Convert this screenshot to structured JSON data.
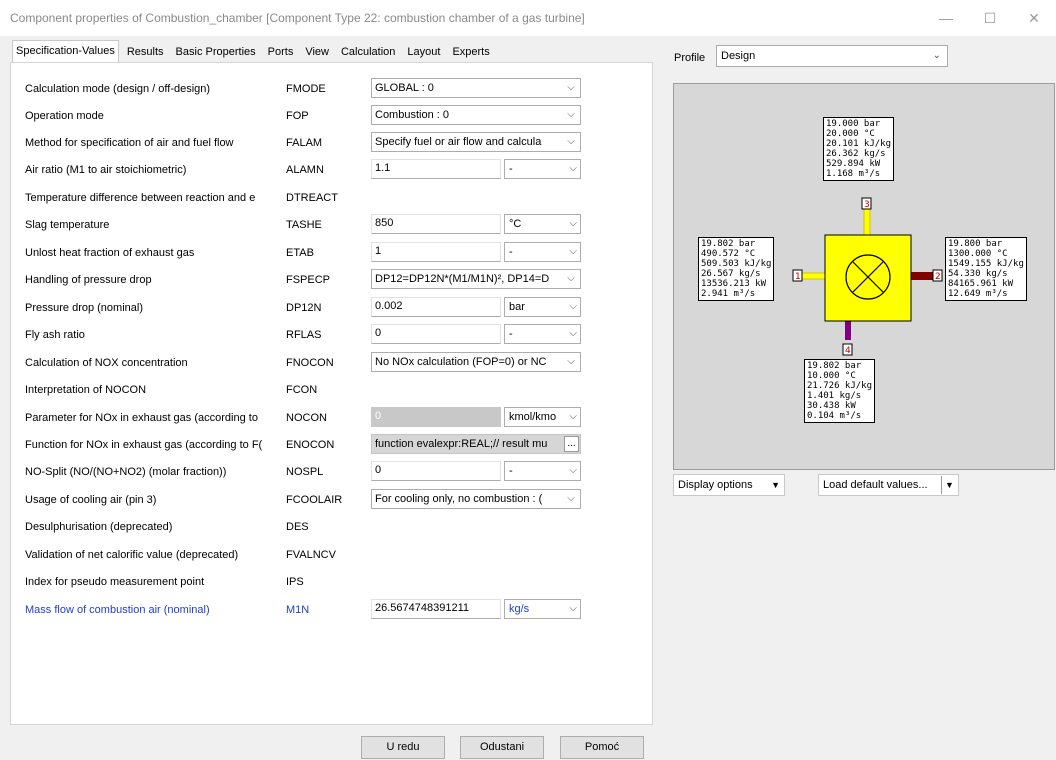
{
  "window": {
    "title": "Component properties of Combustion_chamber   [Component Type 22: combustion chamber of a gas turbine]",
    "minimize": "—",
    "maximize": "☐",
    "close": "✕"
  },
  "tabs": [
    {
      "label": "Specification-Values",
      "active": true
    },
    {
      "label": "Results"
    },
    {
      "label": "Basic Properties"
    },
    {
      "label": "Ports"
    },
    {
      "label": "View"
    },
    {
      "label": "Calculation"
    },
    {
      "label": "Layout"
    },
    {
      "label": "Experts"
    }
  ],
  "rows": [
    {
      "label": "Calculation mode (design / off-design)",
      "code": "FMODE",
      "type": "combo",
      "value": "GLOBAL : 0"
    },
    {
      "label": "Operation mode",
      "code": "FOP",
      "type": "combo",
      "value": "Combustion : 0"
    },
    {
      "label": "Method for specification of air and fuel flow",
      "code": "FALAM",
      "type": "combo",
      "value": "Specify fuel or air flow and calcula"
    },
    {
      "label": "Air ratio (M1 to air stoichiometric)",
      "code": "ALAMN",
      "type": "input",
      "value": "1.1",
      "unit": "-"
    },
    {
      "label": "Temperature difference between reaction and e",
      "code": "DTREACT",
      "type": "none"
    },
    {
      "label": "Slag temperature",
      "code": "TASHE",
      "type": "input",
      "value": "850",
      "unit": "°C"
    },
    {
      "label": "Unlost heat fraction of exhaust gas",
      "code": "ETAB",
      "type": "input",
      "value": "1",
      "unit": "-"
    },
    {
      "label": "Handling of pressure drop",
      "code": "FSPECP",
      "type": "combo",
      "value": "DP12=DP12N*(M1/M1N)², DP14=D"
    },
    {
      "label": "Pressure drop (nominal)",
      "code": "DP12N",
      "type": "input",
      "value": "0.002",
      "unit": "bar"
    },
    {
      "label": "Fly ash ratio",
      "code": "RFLAS",
      "type": "input",
      "value": "0",
      "unit": "-"
    },
    {
      "label": "Calculation of NOX concentration",
      "code": "FNOCON",
      "type": "combo",
      "value": "No NOx calculation (FOP=0) or NC"
    },
    {
      "label": "Interpretation of NOCON",
      "code": "FCON",
      "type": "none"
    },
    {
      "label": "Parameter for NOx in exhaust gas (according to",
      "code": "NOCON",
      "type": "input-gray",
      "value": "0",
      "unit": "kmol/kmo"
    },
    {
      "label": "Function for NOx in exhaust gas (according to F(",
      "code": "ENOCON",
      "type": "func",
      "value": "function evalexpr:REAL;// result mu"
    },
    {
      "label": "NO-Split (NO/(NO+NO2) (molar fraction))",
      "code": "NOSPL",
      "type": "input",
      "value": "0",
      "unit": "-"
    },
    {
      "label": "Usage of cooling air (pin 3)",
      "code": "FCOOLAIR",
      "type": "combo",
      "value": "For cooling only, no combustion : ("
    },
    {
      "label": "Desulphurisation (deprecated)",
      "code": "DES",
      "type": "none"
    },
    {
      "label": "Validation of net calorific value (deprecated)",
      "code": "FVALNCV",
      "type": "none"
    },
    {
      "label": "Index for pseudo measurement point",
      "code": "IPS",
      "type": "none"
    },
    {
      "label": "Mass flow of combustion air (nominal)",
      "code": "M1N",
      "type": "input",
      "value": "26.5674748391211",
      "unit": "kg/s",
      "highlight": true
    }
  ],
  "buttons": {
    "ok": "U redu",
    "cancel": "Odustani",
    "help": "Pomoć"
  },
  "profile": {
    "label": "Profile",
    "value": "Design"
  },
  "diagram": {
    "box_top": "19.000 bar\n20.000 °C\n20.101 kJ/kg\n26.362 kg/s\n529.894 kW\n1.168 m³/s",
    "box_left": "19.802 bar\n490.572 °C\n509.503 kJ/kg\n26.567 kg/s\n13536.213 kW\n2.941 m³/s",
    "box_right": "19.800 bar\n1300.000 °C\n1549.155 kJ/kg\n54.330 kg/s\n84165.961 kW\n12.649 m³/s",
    "box_bottom": "19.802 bar\n10.000 °C\n21.726 kJ/kg\n1.401 kg/s\n30.438 kW\n0.104 m³/s",
    "pins": [
      "1",
      "2",
      "3",
      "4"
    ],
    "colors": {
      "component": "#ffff00",
      "air": "#ffff00",
      "exhaust": "#800000",
      "fuel": "#800080"
    }
  },
  "display_options": "Display options",
  "load_defaults": "Load default values..."
}
